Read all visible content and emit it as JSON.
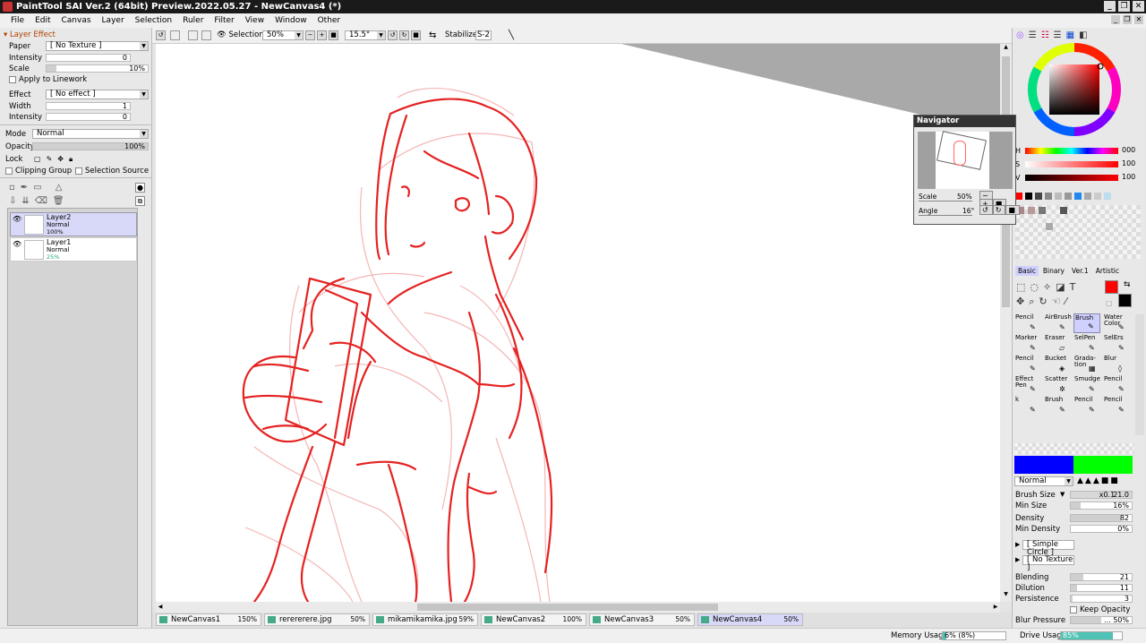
{
  "title": "PaintTool SAI Ver.2 (64bit) Preview.2022.05.27 - NewCanvas4 (*)",
  "window_buttons": [
    "_",
    "❐",
    "✕"
  ],
  "menu": [
    "File",
    "Edit",
    "Canvas",
    "Layer",
    "Selection",
    "Ruler",
    "Filter",
    "View",
    "Window",
    "Other"
  ],
  "mdi_buttons": [
    "_",
    "❐",
    "✕"
  ],
  "layer_effect": {
    "header": "Layer Effect",
    "paper_label": "Paper",
    "paper_value": "[ No Texture ]",
    "intensity_label": "Intensity",
    "intensity_value": "0",
    "scale_label": "Scale",
    "scale_value": "10%",
    "apply_label": "Apply to Linework",
    "effect_label": "Effect",
    "effect_value": "[ No effect ]",
    "width_label": "Width",
    "width_value": "1",
    "intensity2_label": "Intensity",
    "intensity2_value": "0"
  },
  "layer_props": {
    "mode_label": "Mode",
    "mode_value": "Normal",
    "opacity_label": "Opacity",
    "opacity_value": "100%",
    "opacity_fraction": 1.0,
    "lock_label": "Lock",
    "clipping_label": "Clipping Group",
    "selection_source_label": "Selection Source"
  },
  "layers": [
    {
      "name": "Layer2",
      "mode": "Normal",
      "opacity": "100%",
      "selected": true
    },
    {
      "name": "Layer1",
      "mode": "Normal",
      "opacity": "25%",
      "selected": false
    }
  ],
  "toolbar": {
    "selection_label": "Selection",
    "zoom_value": "50%",
    "angle_value": "15.5°",
    "stabilizer_label": "Stabilizer",
    "stabilizer_value": "S-2"
  },
  "navigator": {
    "title": "Navigator",
    "scale_label": "Scale",
    "scale_value": "50%",
    "angle_label": "Angle",
    "angle_value": "16°"
  },
  "color": {
    "h_label": "H",
    "h_value": "000",
    "s_label": "S",
    "s_value": "100",
    "v_label": "V",
    "v_value": "100",
    "primary": "#ff0000",
    "secondary": "#000000"
  },
  "tool_tabs": [
    "Basic",
    "Binary",
    "Ver.1",
    "Artistic"
  ],
  "tools": [
    {
      "name": "Pencil",
      "glyph": "✎"
    },
    {
      "name": "AirBrush",
      "glyph": "✎"
    },
    {
      "name": "Brush",
      "glyph": "✎",
      "selected": true
    },
    {
      "name": "Water Color",
      "glyph": "✎"
    },
    {
      "name": "Marker",
      "glyph": "✎"
    },
    {
      "name": "Eraser",
      "glyph": "▱"
    },
    {
      "name": "SelPen",
      "glyph": "✎"
    },
    {
      "name": "SelErs",
      "glyph": "✎"
    },
    {
      "name": "Pencil",
      "glyph": "✎"
    },
    {
      "name": "Bucket",
      "glyph": "◈"
    },
    {
      "name": "Grada-tion",
      "glyph": "▦"
    },
    {
      "name": "Blur",
      "glyph": "◊"
    },
    {
      "name": "Effect Pen",
      "glyph": "✎"
    },
    {
      "name": "Scatter",
      "glyph": "✲"
    },
    {
      "name": "Smudge",
      "glyph": "✎"
    },
    {
      "name": "Pencil",
      "glyph": "✎"
    },
    {
      "name": "k",
      "glyph": "✎"
    },
    {
      "name": "Brush",
      "glyph": "✎"
    },
    {
      "name": "Pencil",
      "glyph": "✎"
    },
    {
      "name": "Pencil",
      "glyph": "✎"
    }
  ],
  "brush": {
    "mode_value": "Normal",
    "size_label": "Brush Size",
    "size_mult": "x0.1",
    "size_value": "21.0",
    "min_size_label": "Min Size",
    "min_size_value": "16%",
    "density_label": "Density",
    "density_value": "82",
    "min_density_label": "Min Density",
    "min_density_value": "0%",
    "shape_value": "[ Simple Circle ]",
    "texture_value": "[ No Texture ]",
    "blending_label": "Blending",
    "blending_value": "21",
    "dilution_label": "Dilution",
    "dilution_value": "11",
    "persistence_label": "Persistence",
    "persistence_value": "3",
    "keep_opacity_label": "Keep Opacity",
    "blur_pressure_label": "Blur Pressure",
    "blur_pressure_value": "... 50%"
  },
  "tabs": [
    {
      "name": "NewCanvas1",
      "zoom": "150%"
    },
    {
      "name": "rerererere.jpg",
      "zoom": "50%"
    },
    {
      "name": "mikamikamika.jpg",
      "zoom": "59%"
    },
    {
      "name": "NewCanvas2",
      "zoom": "100%"
    },
    {
      "name": "NewCanvas3",
      "zoom": "50%"
    },
    {
      "name": "NewCanvas4",
      "zoom": "50%",
      "active": true
    }
  ],
  "status": {
    "memory_label": "Memory Usage",
    "memory_value": "6% (8%)",
    "memory_fraction": 0.06,
    "drive_label": "Drive Usage",
    "drive_value": "85%",
    "drive_fraction": 0.85
  }
}
